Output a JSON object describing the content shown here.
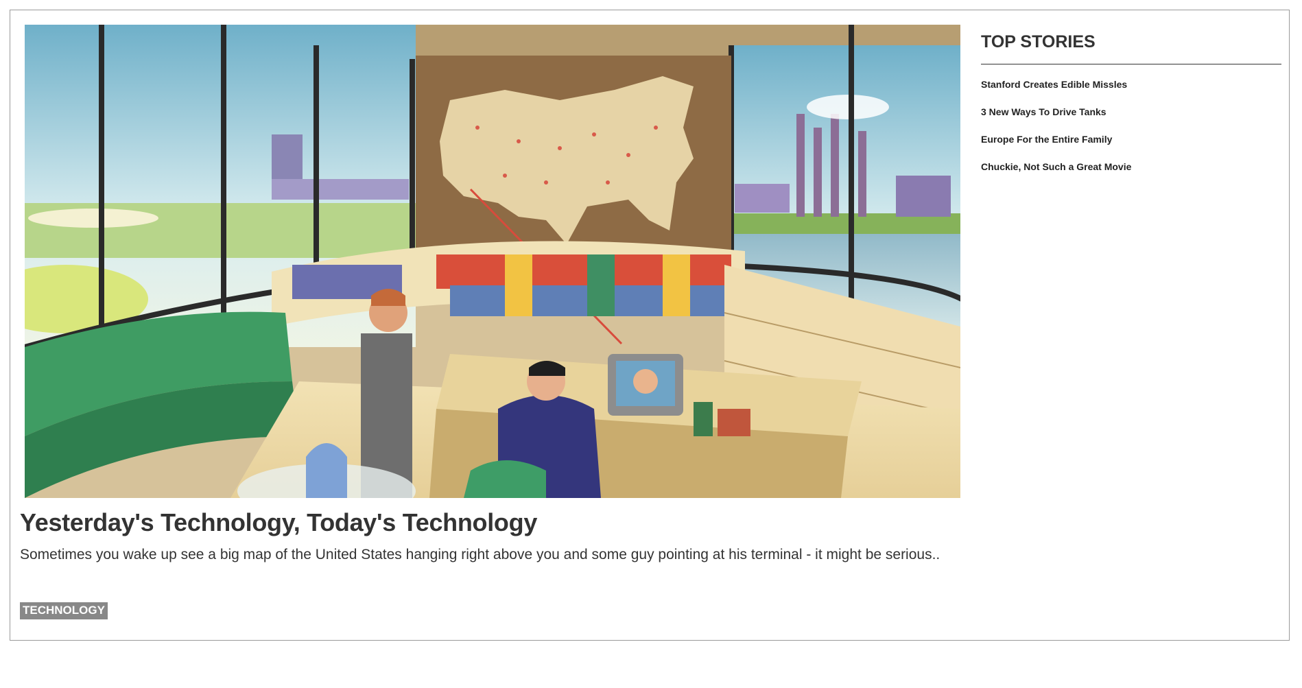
{
  "feature": {
    "image_alt": "Retro illustration of an office control room with a large map of the United States, bookshelves, and two men at a terminal",
    "headline": "Yesterday's Technology, Today's Technology",
    "summary": "Sometimes you wake up see a big map of the United States hanging right above you and some guy pointing at his terminal - it might be serious..",
    "category_tag": "TECHNOLOGY"
  },
  "sidebar": {
    "title": "TOP STORIES",
    "stories": [
      "Stanford Creates Edible Missles",
      "3 New Ways To Drive Tanks",
      "Europe For the Entire Family",
      "Chuckie, Not Such a Great Movie"
    ]
  },
  "colors": {
    "frame_border": "#9a9a9a",
    "text": "#333333",
    "tag_background": "#888888",
    "tag_text": "#ffffff"
  }
}
